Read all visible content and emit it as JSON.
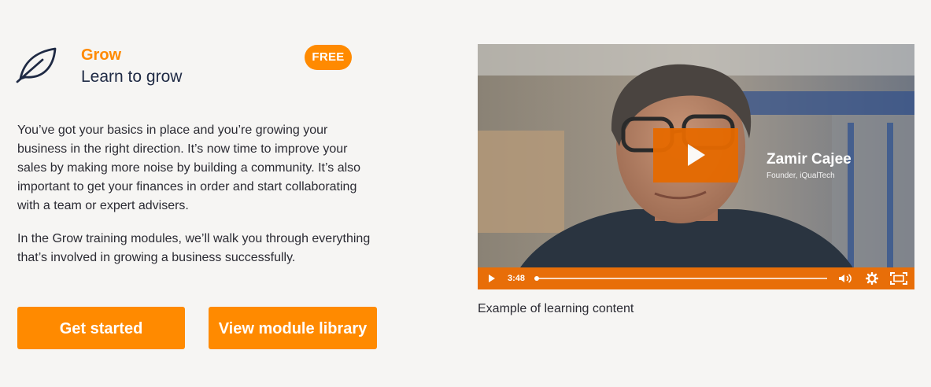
{
  "module": {
    "icon": "leaf-icon",
    "title": "Grow",
    "subtitle": "Learn to grow",
    "badge": "FREE"
  },
  "description": {
    "paragraph1": "You’ve got your basics in place and you’re growing your business in the right direction. It’s now time to improve your sales by making more noise by building a community. It’s also important to get your finances in order and start collaborating with a team or expert advisers.",
    "paragraph2": "In the Grow training modules, we’ll walk you through everything that’s involved in growing a business successfully."
  },
  "buttons": {
    "get_started": "Get started",
    "view_library": "View module library"
  },
  "video": {
    "speaker_name": "Zamir Cajee",
    "speaker_role": "Founder, iQualTech",
    "duration": "3:48",
    "progress": 0.0,
    "caption": "Example of learning content",
    "icons": [
      "play-icon",
      "volume-icon",
      "settings-gear-icon",
      "fullscreen-icon"
    ]
  },
  "colors": {
    "accent": "#ff8a00",
    "video_controls": "#e86e08",
    "heading_dark": "#1f2a44",
    "background": "#f6f5f3"
  }
}
